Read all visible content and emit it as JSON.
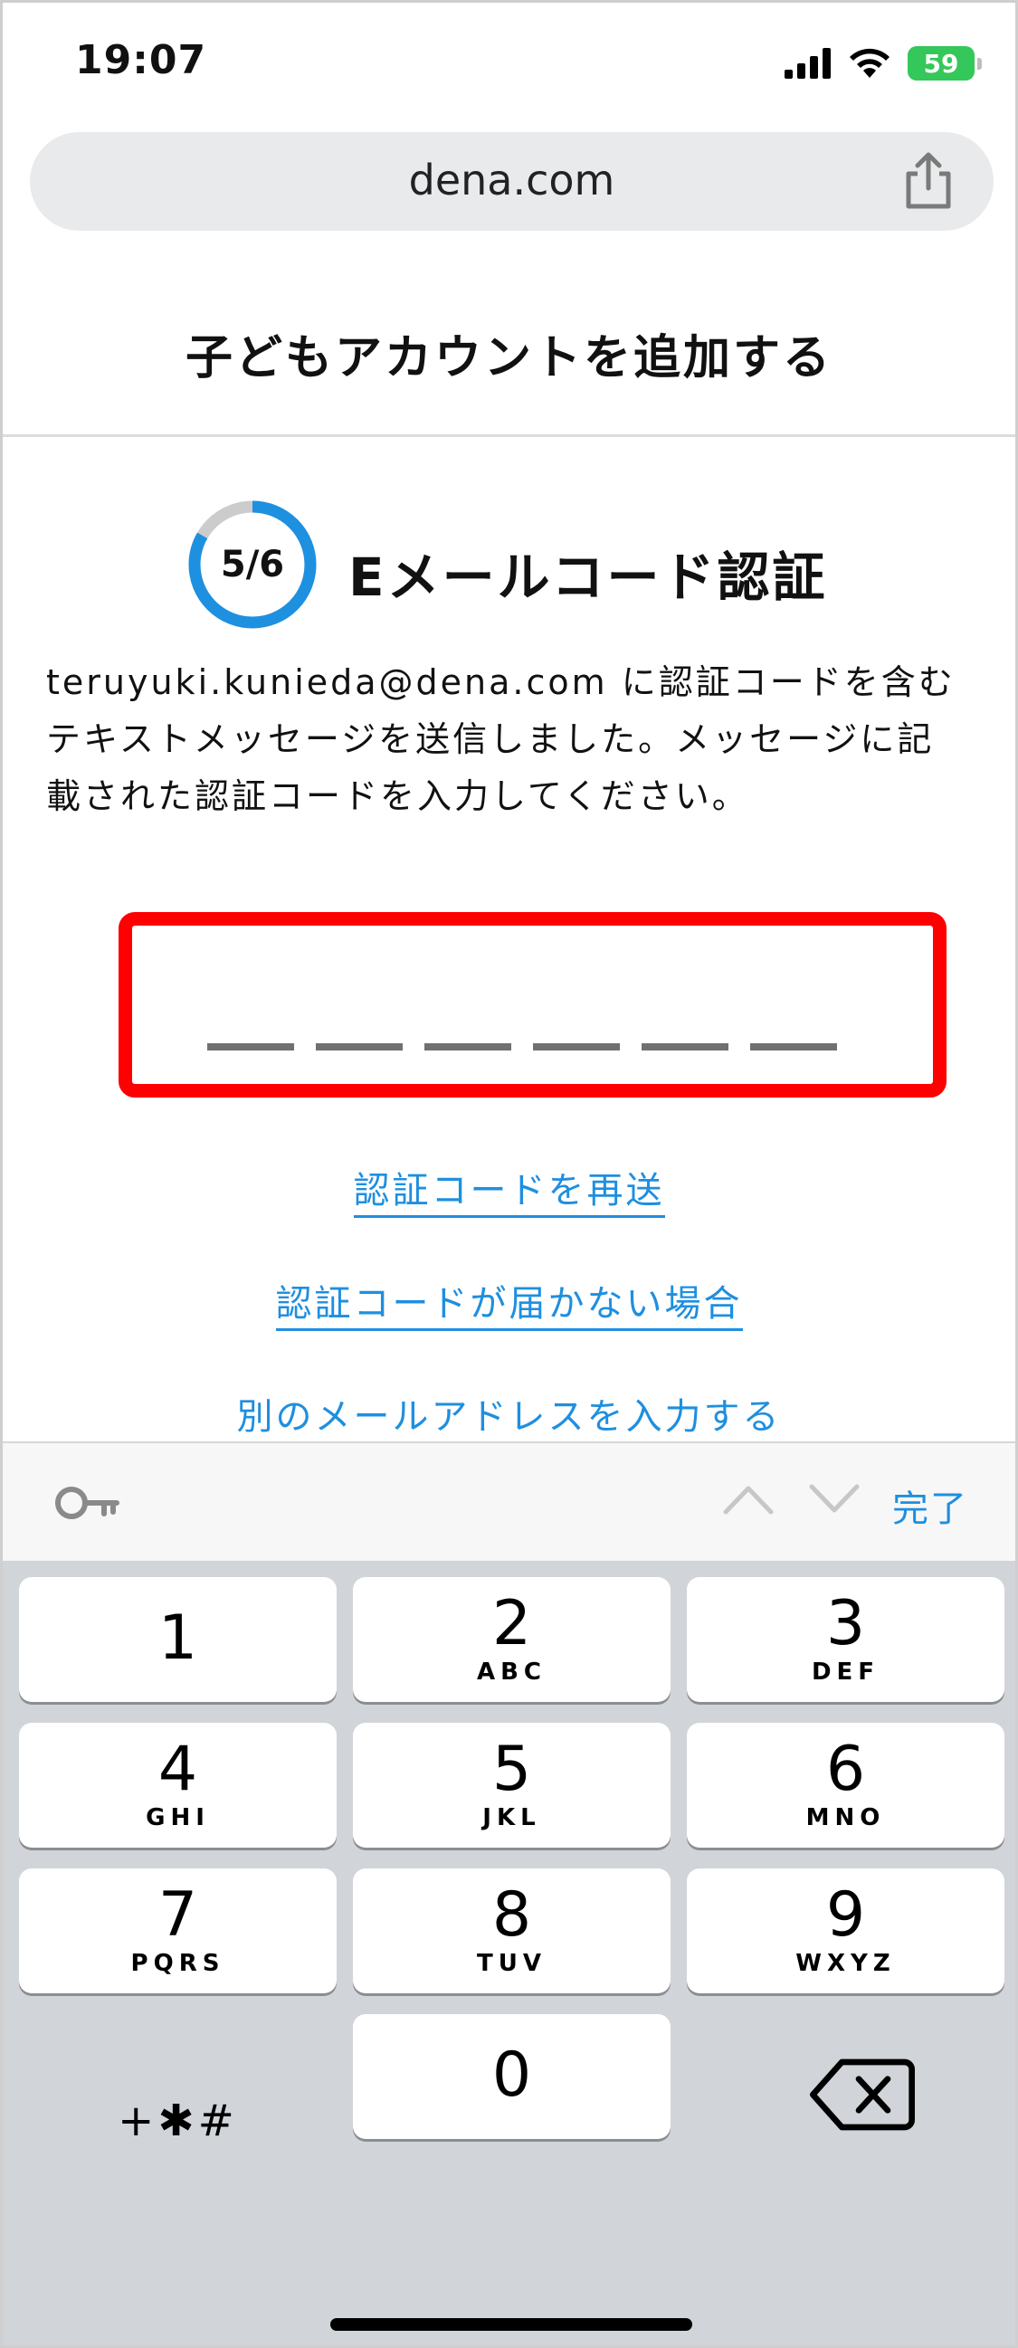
{
  "status_bar": {
    "time": "19:07",
    "battery": "59",
    "icons": [
      "signal-icon",
      "wifi-icon",
      "battery-charging-icon"
    ]
  },
  "browser": {
    "url": "dena.com",
    "share_icon": "share-icon"
  },
  "page": {
    "title": "子どもアカウントを追加する",
    "step": {
      "label": "5/6",
      "current": 5,
      "total": 6,
      "title": "Eメールコード認証"
    },
    "description": "teruyuki.kunieda@dena.com に認証コードを含むテキストメッセージを送信しました。メッセージに記載された認証コードを入力してください。",
    "code": {
      "value": "",
      "length": 6
    },
    "links": {
      "resend": "認証コードを再送",
      "not_received": "認証コードが届かない場合",
      "other_email": "別のメールアドレスを入力する"
    }
  },
  "keyboard": {
    "accessory": {
      "key_icon": "key-icon",
      "done": "完了"
    },
    "keys": [
      {
        "digit": "1",
        "letters": ""
      },
      {
        "digit": "2",
        "letters": "ABC"
      },
      {
        "digit": "3",
        "letters": "DEF"
      },
      {
        "digit": "4",
        "letters": "GHI"
      },
      {
        "digit": "5",
        "letters": "JKL"
      },
      {
        "digit": "6",
        "letters": "MNO"
      },
      {
        "digit": "7",
        "letters": "PQRS"
      },
      {
        "digit": "8",
        "letters": "TUV"
      },
      {
        "digit": "9",
        "letters": "WXYZ"
      },
      {
        "digit": "0",
        "letters": ""
      }
    ],
    "symbols": "+✱#",
    "delete_icon": "backspace-icon"
  },
  "colors": {
    "link": "#1e8fe0",
    "highlight_border": "#ff0000",
    "progress": "#1e90e0",
    "progress_track": "#cccccc",
    "keyboard_bg": "#d1d4d9"
  }
}
